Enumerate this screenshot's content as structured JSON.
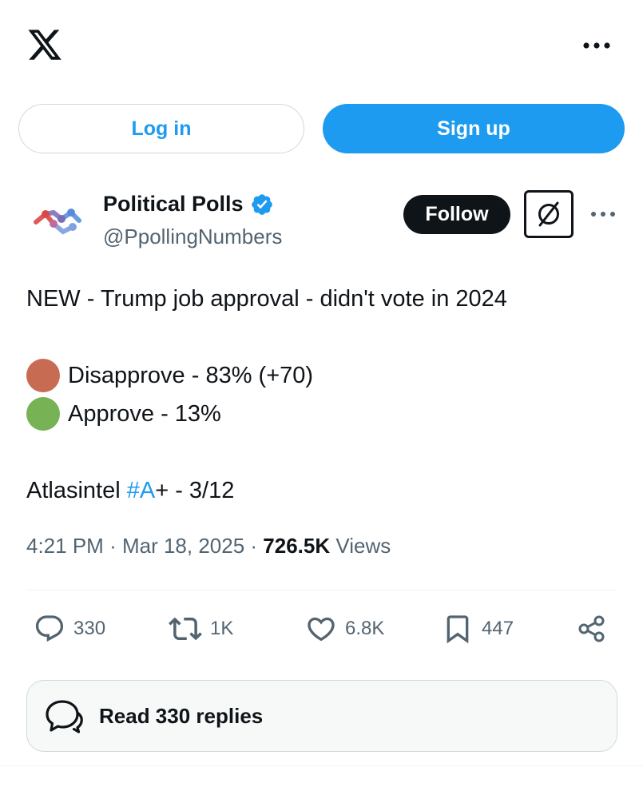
{
  "auth": {
    "login_label": "Log in",
    "signup_label": "Sign up"
  },
  "author": {
    "name": "Political Polls",
    "handle": "@PpollingNumbers",
    "verified": true,
    "follow_label": "Follow"
  },
  "tweet": {
    "line1": "NEW - Trump job approval - didn't vote in 2024",
    "disapprove": {
      "text": "Disapprove - 83% (+70)",
      "color": "#c86b53"
    },
    "approve": {
      "text": "Approve - 13%",
      "color": "#77b255"
    },
    "source_prefix": "Atlasintel ",
    "hashtag": "#A",
    "source_suffix": "+ - 3/12"
  },
  "meta": {
    "time": "4:21 PM",
    "date": "Mar 18, 2025",
    "views_count": "726.5K",
    "views_label": "Views"
  },
  "actions": {
    "replies": "330",
    "reposts": "1K",
    "likes": "6.8K",
    "bookmarks": "447"
  },
  "read_replies_label": "Read 330 replies",
  "colors": {
    "accent": "#1d9bf0",
    "text": "#0f1419",
    "secondary": "#536471",
    "border": "#cfd9de"
  },
  "icons": [
    "x-logo-icon",
    "more-icon",
    "verified-badge-icon",
    "grok-icon",
    "reply-icon",
    "repost-icon",
    "like-icon",
    "bookmark-icon",
    "share-icon",
    "chat-bubbles-icon"
  ]
}
